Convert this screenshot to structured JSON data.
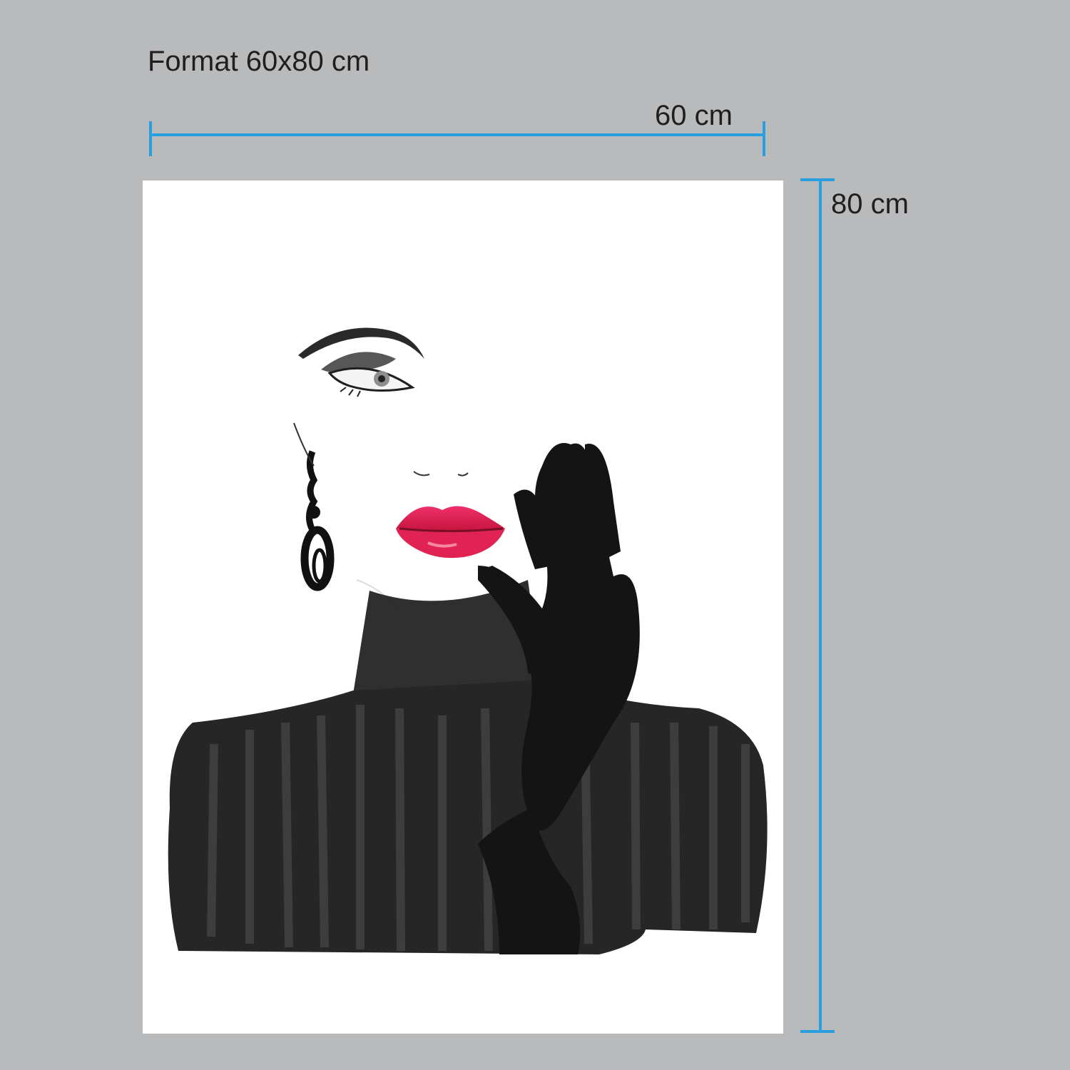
{
  "format_title": "Format 60x80 cm",
  "width_label": "60 cm",
  "height_label": "80 cm",
  "colors": {
    "background": "#b9babc",
    "measure_line": "#2a9fe0",
    "text": "#1f1f1f",
    "poster_background": "#ffffff",
    "ink": "#1b1b1b",
    "lips": "#e8204f"
  },
  "artwork": {
    "subject": "watercolor fashion illustration",
    "elements": [
      "eye",
      "eyebrow",
      "nose",
      "red-lips",
      "drop-earring",
      "black-glove-hand",
      "black-turtleneck"
    ]
  }
}
